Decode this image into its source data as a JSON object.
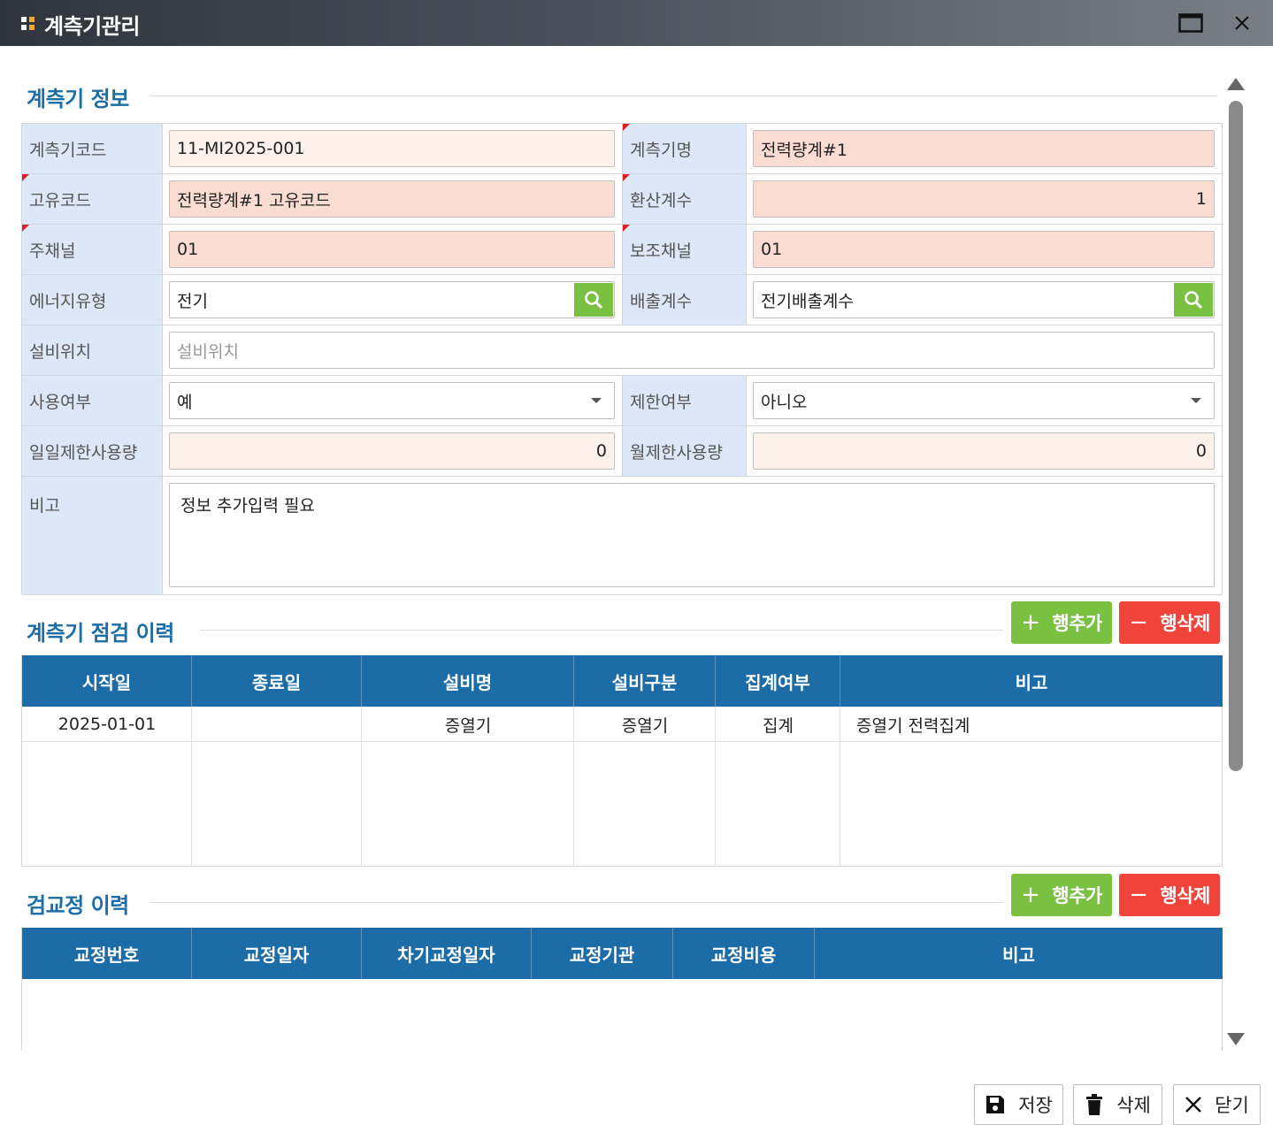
{
  "window": {
    "title": "계측기관리",
    "accent": "#1d6ea8",
    "grip_colors": [
      "#ffffff",
      "#f2a92b"
    ]
  },
  "meter_info": {
    "section_title": "계측기 정보",
    "labels": {
      "code": "계측기코드",
      "name": "계측기명",
      "unique_code": "고유코드",
      "conversion": "환산계수",
      "main_channel": "주채널",
      "sub_channel": "보조채널",
      "energy_type": "에너지유형",
      "emission": "배출계수",
      "location": "설비위치",
      "use_yn": "사용여부",
      "limit_yn": "제한여부",
      "daily_limit": "일일제한사용량",
      "monthly_limit": "월제한사용량",
      "remark": "비고"
    },
    "values": {
      "code": "11-MI2025-001",
      "name": "전력량계#1",
      "unique_code": "전력량계#1 고유코드",
      "conversion": "1",
      "main_channel": "01",
      "sub_channel": "01",
      "energy_type": "전기",
      "emission": "전기배출계수",
      "location_placeholder": "설비위치",
      "use_yn": "예",
      "limit_yn": "아니오",
      "daily_limit": "0",
      "monthly_limit": "0",
      "remark": "정보 추가입력 필요"
    }
  },
  "inspection": {
    "section_title": "계측기 점검 이력",
    "add_label": "행추가",
    "delete_label": "행삭제",
    "columns": [
      "시작일",
      "종료일",
      "설비명",
      "설비구분",
      "집계여부",
      "비고"
    ],
    "rows": [
      [
        "2025-01-01",
        "",
        "증열기",
        "증열기",
        "집계",
        "증열기 전력집계"
      ]
    ]
  },
  "calibration": {
    "section_title": "검교정 이력",
    "add_label": "행추가",
    "delete_label": "행삭제",
    "columns": [
      "교정번호",
      "교정일자",
      "차기교정일자",
      "교정기관",
      "교정비용",
      "비고"
    ]
  },
  "footer": {
    "save_label": "저장",
    "delete_label": "삭제",
    "close_label": "닫기"
  }
}
